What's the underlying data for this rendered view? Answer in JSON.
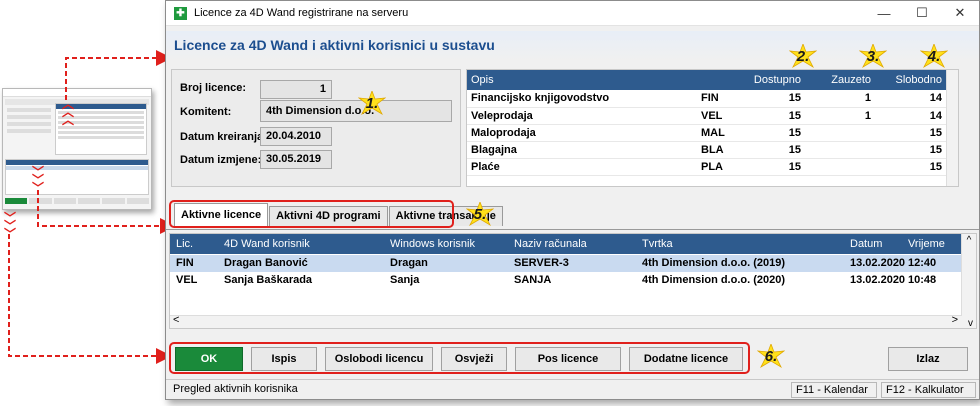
{
  "window": {
    "title": "Licence za 4D Wand registrirane na serveru",
    "heading": "Licence za 4D Wand i aktivni korisnici u sustavu",
    "minimize_glyph": "—",
    "maximize_glyph": "☐",
    "close_glyph": "✕"
  },
  "info": {
    "broj_licence_label": "Broj licence:",
    "broj_licence_value": "1",
    "komitent_label": "Komitent:",
    "komitent_value": "4th Dimension d.o.o.",
    "datum_kreiranja_label": "Datum kreiranja:",
    "datum_kreiranja_value": "20.04.2010",
    "datum_izmjene_label": "Datum izmjene:",
    "datum_izmjene_value": "30.05.2019"
  },
  "licences": {
    "headers": {
      "opis": "Opis",
      "kod": "",
      "dostupno": "Dostupno",
      "zauzeto": "Zauzeto",
      "slobodno": "Slobodno"
    },
    "rows": [
      {
        "opis": "Financijsko knjigovodstvo",
        "kod": "FIN",
        "dostupno": "15",
        "zauzeto": "1",
        "slobodno": "14"
      },
      {
        "opis": "Veleprodaja",
        "kod": "VEL",
        "dostupno": "15",
        "zauzeto": "1",
        "slobodno": "14"
      },
      {
        "opis": "Maloprodaja",
        "kod": "MAL",
        "dostupno": "15",
        "zauzeto": "",
        "slobodno": "15"
      },
      {
        "opis": "Blagajna",
        "kod": "BLA",
        "dostupno": "15",
        "zauzeto": "",
        "slobodno": "15"
      },
      {
        "opis": "Plaće",
        "kod": "PLA",
        "dostupno": "15",
        "zauzeto": "",
        "slobodno": "15"
      }
    ]
  },
  "tabs": [
    "Aktivne licence",
    "Aktivni 4D programi",
    "Aktivne transakcije"
  ],
  "users": {
    "headers": [
      "Lic.",
      "4D Wand korisnik",
      "Windows korisnik",
      "Naziv računala",
      "Tvrtka",
      "Datum",
      "Vrijeme"
    ],
    "rows": [
      [
        "FIN",
        "Dragan Banović",
        "Dragan",
        "SERVER-3",
        "4th Dimension d.o.o. (2019)",
        "13.02.2020",
        "12:40"
      ],
      [
        "VEL",
        "Sanja Baškarada",
        "Sanja",
        "SANJA",
        "4th Dimension d.o.o. (2020)",
        "13.02.2020",
        "10:48"
      ]
    ],
    "scroll_left_glyph": "<",
    "scroll_right_glyph": ">",
    "scroll_up_glyph": "^",
    "scroll_down_glyph": "v"
  },
  "buttons": {
    "ok": "OK",
    "ispis": "Ispis",
    "oslobodi": "Oslobodi licencu",
    "osvjezi": "Osvježi",
    "pos": "Pos licence",
    "dodatne": "Dodatne licence",
    "izlaz": "Izlaz"
  },
  "status": {
    "text": "Pregled aktivnih korisnika",
    "f11": "F11 - Kalendar",
    "f12": "F12 - Kalkulator"
  },
  "callouts": [
    "1.",
    "2.",
    "3.",
    "4.",
    "5.",
    "6."
  ],
  "colors": {
    "accent": "#e0201c",
    "header_blue": "#2e5b8e",
    "ok_green": "#1a8a3a",
    "callout_yellow": "#ffe11a"
  }
}
